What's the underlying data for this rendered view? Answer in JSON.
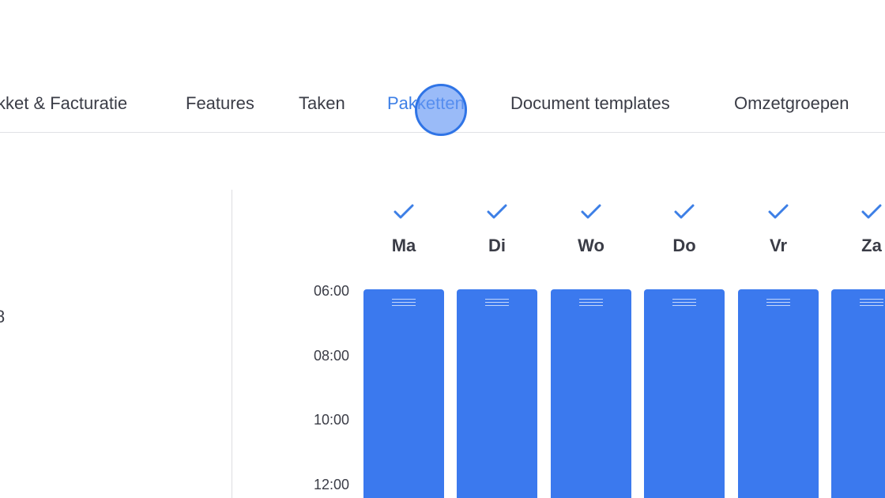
{
  "tabs": [
    {
      "label": "kket & Facturatie",
      "active": false
    },
    {
      "label": "Features",
      "active": false
    },
    {
      "label": "Taken",
      "active": false
    },
    {
      "label": "Pakketten",
      "active": true
    },
    {
      "label": "Document templates",
      "active": false
    },
    {
      "label": "Omzetgroepen",
      "active": false
    }
  ],
  "left_panel": {
    "fragment_text": "8"
  },
  "schedule": {
    "days": [
      {
        "label": "Ma",
        "checked": true
      },
      {
        "label": "Di",
        "checked": true
      },
      {
        "label": "Wo",
        "checked": true
      },
      {
        "label": "Do",
        "checked": true
      },
      {
        "label": "Vr",
        "checked": true
      },
      {
        "label": "Za",
        "checked": true
      }
    ],
    "times": [
      "06:00",
      "08:00",
      "10:00",
      "12:00"
    ]
  },
  "colors": {
    "accent": "#3d7fe6",
    "block": "#3b79ee",
    "text": "#3a3c46"
  },
  "icons": {
    "check": "check-icon",
    "drag_handle": "drag-handle-icon"
  }
}
